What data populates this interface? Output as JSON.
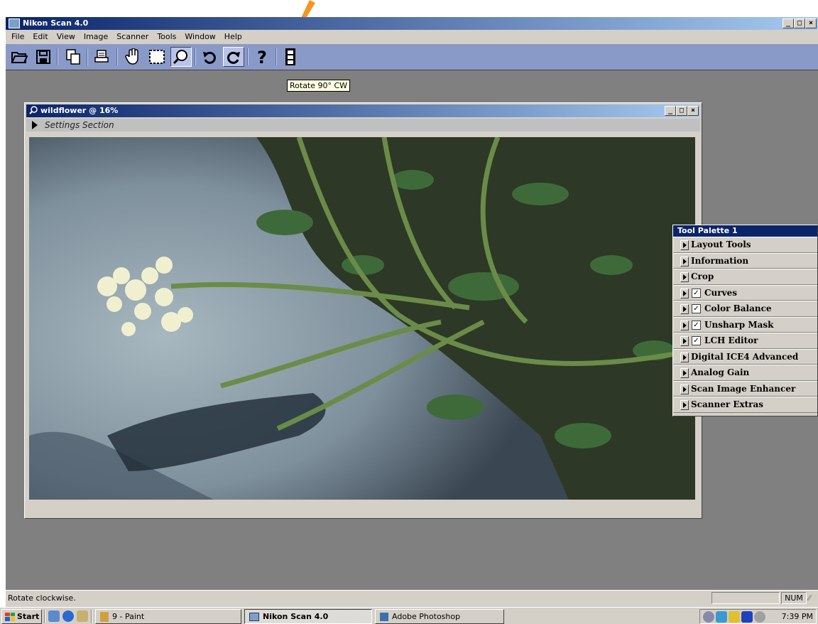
{
  "app": {
    "title": "Nikon Scan 4.0",
    "window_buttons": [
      "_",
      "□",
      "×"
    ]
  },
  "menu": [
    "File",
    "Edit",
    "View",
    "Image",
    "Scanner",
    "Tools",
    "Window",
    "Help"
  ],
  "toolbar": {
    "icons": [
      "open-folder-icon",
      "save-icon",
      "copy-icon",
      "print-icon",
      "hand-tool-icon",
      "marquee-icon",
      "zoom-icon",
      "rotate-ccw-icon",
      "rotate-cw-icon",
      "help-icon",
      "filmstrip-icon"
    ],
    "tooltip": "Rotate 90° CW"
  },
  "document": {
    "title": "wildflower @ 16%",
    "settings_label": "Settings Section"
  },
  "palette": {
    "title": "Tool Palette 1",
    "items": [
      {
        "label": "Layout Tools",
        "checked": false
      },
      {
        "label": "Information",
        "checked": false
      },
      {
        "label": "Crop",
        "checked": false
      },
      {
        "label": "Curves",
        "checked": true
      },
      {
        "label": "Color Balance",
        "checked": true
      },
      {
        "label": "Unsharp Mask",
        "checked": true
      },
      {
        "label": "LCH Editor",
        "checked": true
      },
      {
        "label": "Digital ICE4 Advanced",
        "checked": false
      },
      {
        "label": "Analog Gain",
        "checked": false
      },
      {
        "label": "Scan Image Enhancer",
        "checked": false
      },
      {
        "label": "Scanner Extras",
        "checked": false
      }
    ],
    "check_mark": "✓"
  },
  "status": {
    "text": "Rotate clockwise.",
    "num": "NUM"
  },
  "taskbar": {
    "start": "Start",
    "tasks": [
      "9 - Paint",
      "Nikon Scan 4.0",
      "Adobe Photoshop"
    ],
    "clock": "7:39 PM"
  },
  "colors": {
    "title_active": "#0a246a",
    "toolbar_bg": "#8a9ac8",
    "workspace": "#808080",
    "annotation_arrow": "#f7931e"
  }
}
